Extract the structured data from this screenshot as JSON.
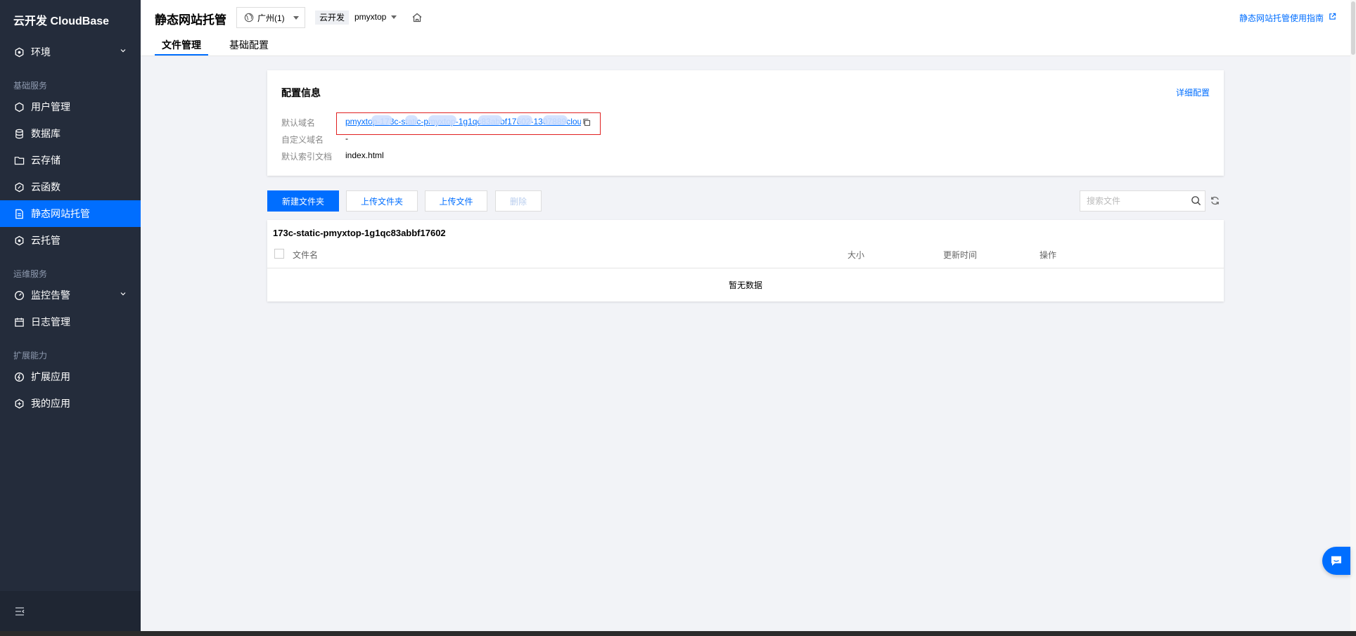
{
  "sidebar": {
    "brand": "云开发 CloudBase",
    "env_item": "环境",
    "groups": {
      "basic": "基础服务",
      "ops": "运维服务",
      "ext": "扩展能力"
    },
    "items": {
      "user_mgmt": "用户管理",
      "database": "数据库",
      "storage": "云存储",
      "functions": "云函数",
      "static_hosting": "静态网站托管",
      "cloud_run": "云托管",
      "monitor": "监控告警",
      "logs": "日志管理",
      "ext_apps": "扩展应用",
      "my_apps": "我的应用"
    }
  },
  "header": {
    "title": "静态网站托管",
    "region": "广州(1)",
    "env_tag": "云开发",
    "env_name": "pmyxtop",
    "guide_link": "静态网站托管使用指南",
    "tabs": [
      "文件管理",
      "基础配置"
    ]
  },
  "config": {
    "title": "配置信息",
    "detail_link": "详细配置",
    "default_domain_label": "默认域名",
    "default_domain_value": "pmyxtop-173c-static-pmyxtop-1g1qc83abbf17602-1307889cloudbase.tcloudbaseapp.com",
    "custom_domain_label": "自定义域名",
    "custom_domain_value": "-",
    "index_doc_label": "默认索引文档",
    "index_doc_value": "index.html"
  },
  "toolbar": {
    "new_folder": "新建文件夹",
    "upload_folder": "上传文件夹",
    "upload_file": "上传文件",
    "delete": "删除",
    "search_placeholder": "搜索文件"
  },
  "table": {
    "bucket": "173c-static-pmyxtop-1g1qc83abbf17602",
    "columns": [
      "文件名",
      "大小",
      "更新时间",
      "操作"
    ],
    "empty": "暂无数据"
  },
  "colors": {
    "accent": "#006eff",
    "sidebar_bg": "#242c3b",
    "highlight": "#e02020"
  }
}
